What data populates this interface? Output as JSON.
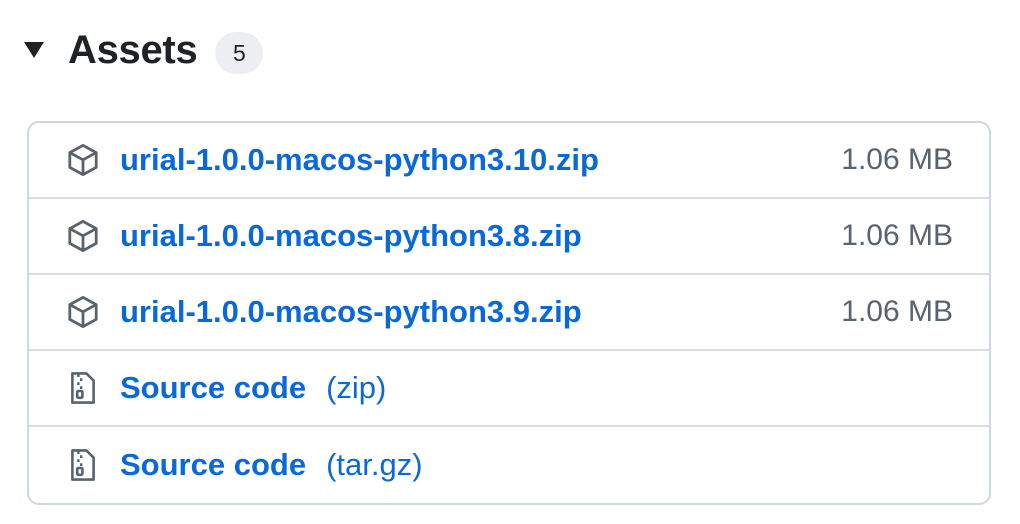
{
  "assets": {
    "title": "Assets",
    "count": "5",
    "items": [
      {
        "icon": "package-icon",
        "name": "urial-1.0.0-macos-python3.10.zip",
        "size": "1.06 MB"
      },
      {
        "icon": "package-icon",
        "name": "urial-1.0.0-macos-python3.8.zip",
        "size": "1.06 MB"
      },
      {
        "icon": "package-icon",
        "name": "urial-1.0.0-macos-python3.9.zip",
        "size": "1.06 MB"
      }
    ],
    "source": [
      {
        "icon": "file-zip-icon",
        "name": "Source code",
        "kind": "(zip)"
      },
      {
        "icon": "file-zip-icon",
        "name": "Source code",
        "kind": "(tar.gz)"
      }
    ]
  },
  "colors": {
    "link": "#0969da",
    "muted": "#59636e",
    "border": "#d0d7de",
    "counter_bg": "#eceef1"
  }
}
